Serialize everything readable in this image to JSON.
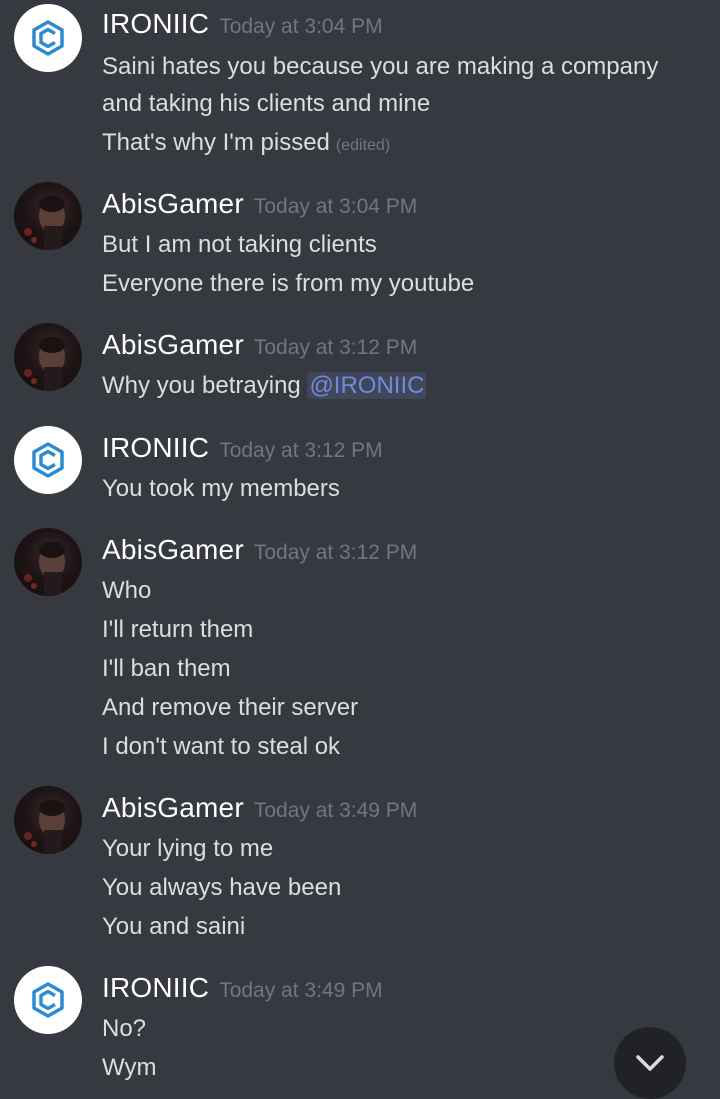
{
  "messages": [
    {
      "user": "IRONIIC",
      "time": "Today at 3:04 PM",
      "lines": [
        "Saini hates you because you are making a company",
        "and taking his clients and mine",
        "That's why I'm pissed"
      ],
      "edited_label": "(edited)"
    },
    {
      "user": "AbisGamer",
      "time": "Today at 3:04 PM",
      "lines": [
        "But I am not taking clients",
        "Everyone there is from my youtube"
      ]
    },
    {
      "user": "AbisGamer",
      "time": "Today at 3:12 PM",
      "lines": [
        "Why you betraying "
      ],
      "mention": "@IRONIIC"
    },
    {
      "user": "IRONIIC",
      "time": "Today at 3:12 PM",
      "lines": [
        "You took my members"
      ]
    },
    {
      "user": "AbisGamer",
      "time": "Today at 3:12 PM",
      "lines": [
        "Who",
        "I'll return them",
        "I'll ban them",
        "And remove their server",
        "I don't want to steal ok"
      ]
    },
    {
      "user": "AbisGamer",
      "time": "Today at 3:49 PM",
      "lines": [
        "Your lying to me",
        "You always have been",
        "You and saini"
      ]
    },
    {
      "user": "IRONIIC",
      "time": "Today at 3:49 PM",
      "lines": [
        "No?",
        "Wym"
      ]
    }
  ],
  "colors": {
    "background": "#36393f",
    "username": "#ffffff",
    "timestamp": "#72767d",
    "message_text": "#dcddde",
    "mention": "#7289da",
    "ironiic_logo": "#2c8ad1"
  },
  "icons": {
    "ironiic_avatar": "ironiic-logo-icon",
    "abis_avatar": "profile-photo",
    "scroll_down": "chevron-down-icon"
  }
}
